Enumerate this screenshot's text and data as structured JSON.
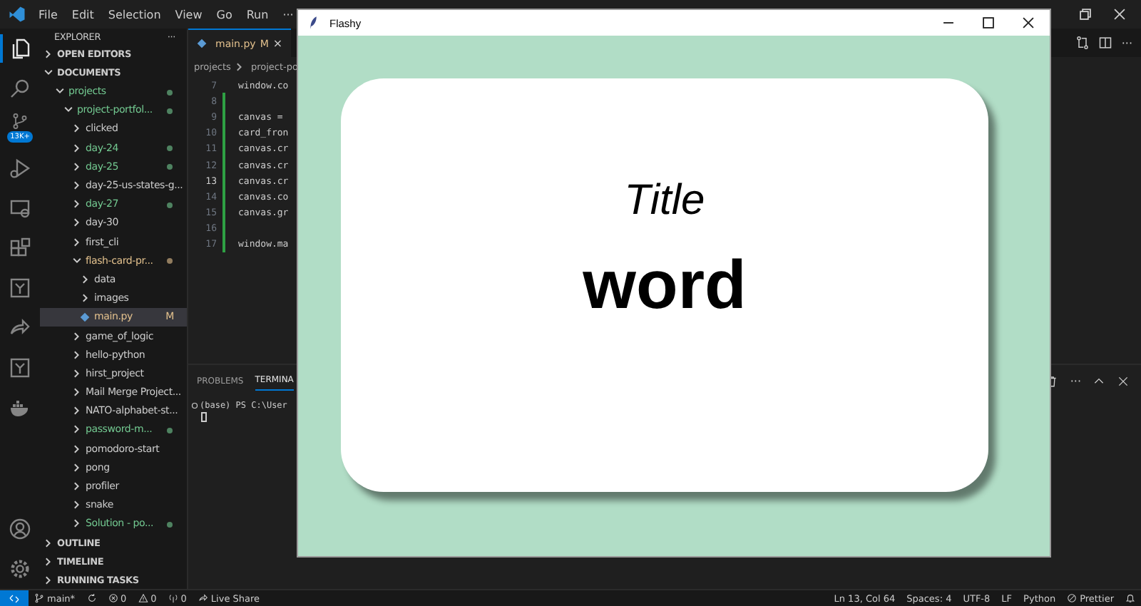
{
  "menu_bar": {
    "items": [
      "File",
      "Edit",
      "Selection",
      "View",
      "Go",
      "Run",
      "···"
    ]
  },
  "activity_bar": {
    "items": [
      {
        "kind": "files",
        "selected": true
      },
      {
        "kind": "search",
        "selected": false
      },
      {
        "kind": "source-control",
        "selected": false,
        "badge": "13K+"
      },
      {
        "kind": "run-debug",
        "selected": false
      },
      {
        "kind": "remote",
        "selected": false
      },
      {
        "kind": "extensions",
        "selected": false
      },
      {
        "kind": "box",
        "selected": false
      },
      {
        "kind": "live-share",
        "selected": false
      },
      {
        "kind": "box",
        "selected": false
      },
      {
        "kind": "docker",
        "selected": false
      }
    ],
    "bottom": [
      {
        "kind": "account"
      },
      {
        "kind": "settings"
      }
    ]
  },
  "sidebar": {
    "title": "EXPLORER",
    "more": "···",
    "sections": [
      {
        "label": "OPEN EDITORS",
        "expanded": false
      },
      {
        "label": "DOCUMENTS",
        "expanded": true,
        "items": [
          {
            "label": "projects",
            "kind": "folder",
            "expanded": true,
            "color": "#73c991",
            "dot": true,
            "selected": false,
            "children": [
              {
                "label": "project-portfol...",
                "kind": "folder",
                "expanded": true,
                "color": "#73c991",
                "dot": true,
                "selected": false,
                "children": [
                  {
                    "label": "clicked",
                    "kind": "folder",
                    "expanded": false,
                    "color": "#cccccc",
                    "dot": false,
                    "selected": false
                  },
                  {
                    "label": "day-24",
                    "kind": "folder",
                    "expanded": false,
                    "color": "#73c991",
                    "dot": true,
                    "selected": false
                  },
                  {
                    "label": "day-25",
                    "kind": "folder",
                    "expanded": false,
                    "color": "#73c991",
                    "dot": true,
                    "selected": false
                  },
                  {
                    "label": "day-25-us-states-g...",
                    "kind": "folder",
                    "expanded": false,
                    "color": "#cccccc",
                    "dot": false,
                    "selected": false
                  },
                  {
                    "label": "day-27",
                    "kind": "folder",
                    "expanded": false,
                    "color": "#73c991",
                    "dot": true,
                    "selected": false
                  },
                  {
                    "label": "day-30",
                    "kind": "folder",
                    "expanded": false,
                    "color": "#cccccc",
                    "dot": false,
                    "selected": false
                  },
                  {
                    "label": "first_cli",
                    "kind": "folder",
                    "expanded": false,
                    "color": "#cccccc",
                    "dot": false,
                    "selected": false
                  },
                  {
                    "label": "flash-card-pr...",
                    "kind": "folder",
                    "expanded": true,
                    "color": "#e2c08d",
                    "dot": true,
                    "selected": false,
                    "children": [
                      {
                        "label": "data",
                        "kind": "folder",
                        "expanded": false,
                        "color": "#cccccc",
                        "dot": false,
                        "selected": false
                      },
                      {
                        "label": "images",
                        "kind": "folder",
                        "expanded": false,
                        "color": "#cccccc",
                        "dot": false,
                        "selected": false
                      },
                      {
                        "label": "main.py",
                        "kind": "file",
                        "color": "#e2c08d",
                        "dot": false,
                        "badge": "M",
                        "selected": true
                      }
                    ]
                  },
                  {
                    "label": "game_of_logic",
                    "kind": "folder",
                    "expanded": false,
                    "color": "#cccccc",
                    "dot": false,
                    "selected": false
                  },
                  {
                    "label": "hello-python",
                    "kind": "folder",
                    "expanded": false,
                    "color": "#cccccc",
                    "dot": false,
                    "selected": false
                  },
                  {
                    "label": "hirst_project",
                    "kind": "folder",
                    "expanded": false,
                    "color": "#cccccc",
                    "dot": false,
                    "selected": false
                  },
                  {
                    "label": "Mail Merge Project...",
                    "kind": "folder",
                    "expanded": false,
                    "color": "#cccccc",
                    "dot": false,
                    "selected": false
                  },
                  {
                    "label": "NATO-alphabet-st...",
                    "kind": "folder",
                    "expanded": false,
                    "color": "#cccccc",
                    "dot": false,
                    "selected": false
                  },
                  {
                    "label": "password-m...",
                    "kind": "folder",
                    "expanded": false,
                    "color": "#73c991",
                    "dot": true,
                    "selected": false
                  },
                  {
                    "label": "pomodoro-start",
                    "kind": "folder",
                    "expanded": false,
                    "color": "#cccccc",
                    "dot": false,
                    "selected": false
                  },
                  {
                    "label": "pong",
                    "kind": "folder",
                    "expanded": false,
                    "color": "#cccccc",
                    "dot": false,
                    "selected": false
                  },
                  {
                    "label": "profiler",
                    "kind": "folder",
                    "expanded": false,
                    "color": "#cccccc",
                    "dot": false,
                    "selected": false
                  },
                  {
                    "label": "snake",
                    "kind": "folder",
                    "expanded": false,
                    "color": "#cccccc",
                    "dot": false,
                    "selected": false
                  },
                  {
                    "label": "Solution - po...",
                    "kind": "folder",
                    "expanded": false,
                    "color": "#73c991",
                    "dot": true,
                    "selected": false
                  }
                ]
              }
            ]
          }
        ]
      },
      {
        "label": "OUTLINE",
        "expanded": false
      },
      {
        "label": "TIMELINE",
        "expanded": false
      },
      {
        "label": "RUNNING TASKS",
        "expanded": false
      }
    ]
  },
  "editor": {
    "tab": {
      "label": "main.py",
      "badge": "M",
      "close": "×"
    },
    "breadcrumbs": [
      "projects",
      "project-po"
    ],
    "more": "···",
    "lines": [
      {
        "number": "7",
        "text": "window.co",
        "current": false,
        "changed": false
      },
      {
        "number": "8",
        "current": false,
        "changed": true
      },
      {
        "number": "9",
        "text": "canvas =",
        "current": false,
        "changed": true
      },
      {
        "number": "10",
        "text": "card_fron",
        "current": false,
        "changed": true
      },
      {
        "number": "11",
        "text": "canvas.cr",
        "current": false,
        "changed": true
      },
      {
        "number": "12",
        "text": "canvas.cr",
        "current": false,
        "changed": true
      },
      {
        "number": "13",
        "text": "canvas.cr",
        "current": true,
        "changed": true
      },
      {
        "number": "14",
        "text": "canvas.co",
        "current": false,
        "changed": true
      },
      {
        "number": "15",
        "text": "canvas.gr",
        "current": false,
        "changed": true
      },
      {
        "number": "16",
        "current": false,
        "changed": true
      },
      {
        "number": "17",
        "text": "window.ma",
        "current": false,
        "changed": true
      }
    ]
  },
  "panel": {
    "tabs": [
      {
        "label": "PROBLEMS",
        "selected": false
      },
      {
        "label": "TERMINA",
        "selected": true
      }
    ],
    "terminal": {
      "prompt": "(base) PS C:\\User"
    },
    "more": "···"
  },
  "status_bar": {
    "left": [
      {
        "kind": "branch",
        "text": "main*"
      },
      {
        "kind": "sync"
      },
      {
        "kind": "errors",
        "text": "0"
      },
      {
        "kind": "warnings",
        "text": "0"
      },
      {
        "kind": "ports",
        "text": "0"
      },
      {
        "kind": "live-share",
        "text": "Live Share"
      }
    ],
    "right": [
      {
        "kind": "text",
        "text": "Ln 13, Col 64"
      },
      {
        "kind": "text",
        "text": "Spaces: 4"
      },
      {
        "kind": "text",
        "text": "UTF-8"
      },
      {
        "kind": "text",
        "text": "LF"
      },
      {
        "kind": "text",
        "text": "Python"
      },
      {
        "kind": "prettier",
        "text": "Prettier"
      },
      {
        "kind": "bell"
      }
    ]
  },
  "app_window": {
    "title": "Flashy",
    "card": {
      "title": "Title",
      "word": "word"
    }
  }
}
